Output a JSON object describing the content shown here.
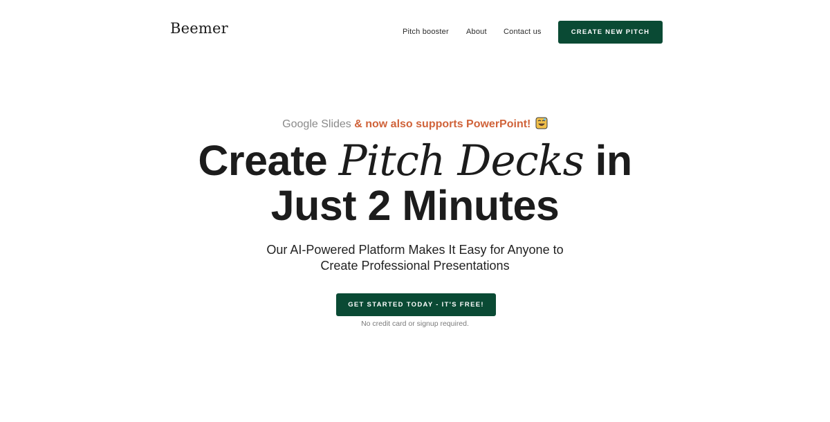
{
  "header": {
    "logo": "Beemer",
    "nav": [
      {
        "label": "Pitch booster"
      },
      {
        "label": "About"
      },
      {
        "label": "Contact us"
      }
    ],
    "cta_label": "CREATE NEW PITCH"
  },
  "hero": {
    "announce_grey": "Google Slides",
    "announce_orange": " & now also supports PowerPoint!",
    "announce_icon": "smiling-face-emoji",
    "headline_part1": "Create ",
    "headline_italic": "Pitch Decks",
    "headline_part2": " in",
    "headline_line2": "Just 2 Minutes",
    "subhead_line1": "Our AI-Powered Platform Makes It Easy for Anyone to",
    "subhead_line2": "Create Professional Presentations",
    "cta_label": "GET STARTED TODAY - IT'S FREE!",
    "note": "No credit card or signup required."
  },
  "colors": {
    "brand_green": "#0a4a34",
    "accent_orange": "#d0633a",
    "muted_grey": "#8a8a8a"
  }
}
